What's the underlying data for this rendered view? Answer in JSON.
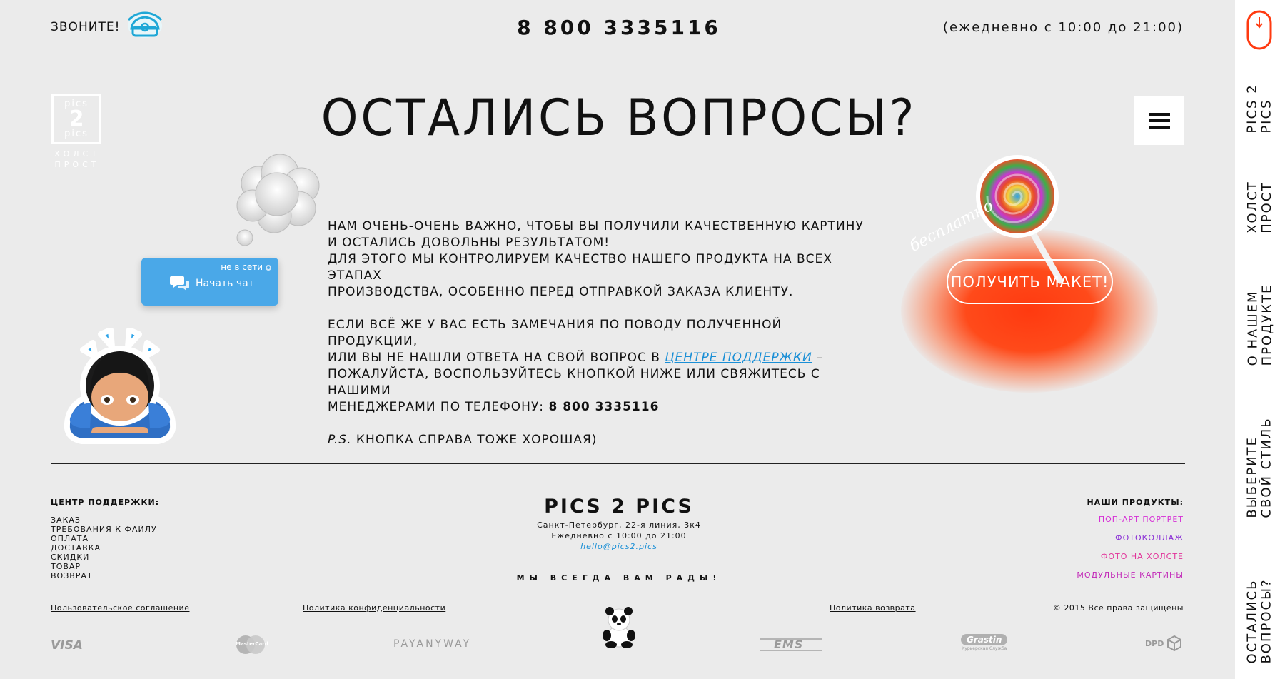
{
  "header": {
    "call_label": "ЗВОНИТЕ!",
    "phone": "8 800 3335116",
    "hours": "(ежедневно с 10:00 до 21:00)"
  },
  "logo": {
    "line1": "pics",
    "line2": "2",
    "line3": "pics",
    "sub1": "ХОЛСТ",
    "sub2": "ПРОСТ"
  },
  "main": {
    "heading": "ОСТАЛИСЬ ВОПРОСЫ?",
    "p1_line1": "НАМ ОЧЕНЬ-ОЧЕНЬ ВАЖНО, ЧТОБЫ ВЫ ПОЛУЧИЛИ КАЧЕСТВЕННУЮ КАРТИНУ",
    "p1_line2": "И ОСТАЛИСЬ ДОВОЛЬНЫ РЕЗУЛЬТАТОМ!",
    "p1_line3": "ДЛЯ ЭТОГО МЫ КОНТРОЛИРУЕМ КАЧЕСТВО НАШЕГО ПРОДУКТА НА ВСЕХ ЭТАПАХ",
    "p1_line4": "ПРОИЗВОДСТВА, ОСОБЕННО ПЕРЕД ОТПРАВКОЙ ЗАКАЗА КЛИЕНТУ.",
    "p2_line1": "ЕСЛИ ВСЁ ЖЕ У ВАС ЕСТЬ ЗАМЕЧАНИЯ ПО ПОВОДУ ПОЛУЧЕННОЙ ПРОДУКЦИИ,",
    "p2_line2_pre": "ИЛИ ВЫ НЕ НАШЛИ ОТВЕТА НА СВОЙ ВОПРОС В ",
    "p2_link": "ЦЕНТРЕ ПОДДЕРЖКИ",
    "p2_line2_post": " –",
    "p2_line3": "ПОЖАЛУЙСТА, ВОСПОЛЬЗУЙТЕСЬ КНОПКОЙ НИЖЕ ИЛИ СВЯЖИТЕСЬ С НАШИМИ",
    "p2_line4_pre": "МЕНЕДЖЕРАМИ ПО ТЕЛЕФОНУ: ",
    "p2_phone": "8 800 3335116",
    "ps_label": "P.S.",
    "ps_text": " КНОПКА СПРАВА ТОЖЕ ХОРОШАЯ)"
  },
  "chat": {
    "status": "не в сети",
    "label": "Начать чат"
  },
  "promo": {
    "free_label": "бесплатно",
    "button": "ПОЛУЧИТЬ МАКЕТ!"
  },
  "sidebar": {
    "items": [
      {
        "label": "PICS 2\nPICS"
      },
      {
        "label": "ХОЛСТ\nПРОСТ"
      },
      {
        "label": "О НАШЕМ\nПРОДУКТЕ"
      },
      {
        "label": "ВЫБЕРИТЕ\nСВОЙ СТИЛЬ"
      },
      {
        "label": "ОСТАЛИСЬ\nВОПРОСЫ?"
      }
    ]
  },
  "footer": {
    "support_title": "ЦЕНТР ПОДДЕРЖКИ:",
    "support_links": [
      "ЗАКАЗ",
      "ТРЕБОВАНИЯ К ФАЙЛУ",
      "ОПЛАТА",
      "ДОСТАВКА",
      "СКИДКИ",
      "ТОВАР",
      "ВОЗВРАТ"
    ],
    "brand": "PICS 2 PICS",
    "address": "Санкт-Петербург, 22-я линия, 3к4",
    "hours": "Ежедневно с 10:00 до 21:00",
    "email": "hello@pics2.pics",
    "slogan": "МЫ ВСЕГДА ВАМ РАДЫ!",
    "products_title": "НАШИ ПРОДУКТЫ:",
    "products": [
      {
        "label": "ПОП-АРТ ПОРТРЕТ",
        "color": "#d62fd6"
      },
      {
        "label": "ФОТОКОЛЛАЖ",
        "color": "#8a2fd6"
      },
      {
        "label": "ФОТО НА ХОЛСТЕ",
        "color": "#e2339a"
      },
      {
        "label": "МОДУЛЬНЫЕ КАРТИНЫ",
        "color": "#c227b8"
      }
    ],
    "user_agreement": "Пользовательское соглашение",
    "privacy": "Политика конфиденциальности",
    "return_policy": "Политика возврата",
    "copyright": "© 2015 Все права защищены",
    "payment_logos": [
      "VISA",
      "MasterCard",
      "PAYANYWAY",
      "EMS",
      "Grastin",
      "DPD"
    ],
    "grastin_sub": "Курьерская Служба"
  },
  "colors": {
    "background": "#ebebeb",
    "accent_orange": "#ff4a1a",
    "chat_blue": "#4aa8e8",
    "link_blue": "#1a8fd6"
  }
}
